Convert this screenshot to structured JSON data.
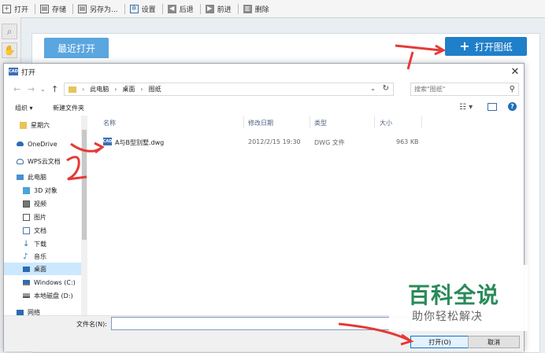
{
  "toolbar": {
    "items": [
      {
        "label": "打开",
        "icon": "plus-icon"
      },
      {
        "label": "存储",
        "icon": "save-icon"
      },
      {
        "label": "另存为...",
        "icon": "save-as-icon"
      },
      {
        "label": "设置",
        "icon": "gear-icon"
      },
      {
        "label": "后退",
        "icon": "back-icon"
      },
      {
        "label": "前进",
        "icon": "forward-icon"
      },
      {
        "label": "删除",
        "icon": "delete-icon"
      }
    ]
  },
  "main": {
    "recent_tab": "最近打开",
    "open_drawing_button": "打开图纸"
  },
  "dialog": {
    "title": "打开",
    "breadcrumb": [
      "此电脑",
      "桌面",
      "图纸"
    ],
    "search_placeholder": "搜索\"图纸\"",
    "organize": "组织 ▾",
    "new_folder": "新建文件夹",
    "nav_items": [
      {
        "label": "星期六",
        "icon": "folder-icon",
        "color": "#e8c35a"
      },
      {
        "label": "OneDrive",
        "icon": "cloud-icon",
        "color": "#2b6cb0"
      },
      {
        "label": "WPS云文档",
        "icon": "cloud-outline-icon",
        "color": "#3a6ea5"
      },
      {
        "label": "此电脑",
        "icon": "computer-icon",
        "color": "#4a8fd1"
      },
      {
        "label": "3D 对象",
        "icon": "cube-icon",
        "color": "#4aa5d8"
      },
      {
        "label": "视频",
        "icon": "video-icon",
        "color": "#555555"
      },
      {
        "label": "图片",
        "icon": "picture-icon",
        "color": "#555555"
      },
      {
        "label": "文档",
        "icon": "document-icon",
        "color": "#5577aa"
      },
      {
        "label": "下载",
        "icon": "download-icon",
        "color": "#2b6cb0"
      },
      {
        "label": "音乐",
        "icon": "music-icon",
        "color": "#2b6cb0"
      },
      {
        "label": "桌面",
        "icon": "desktop-icon",
        "color": "#2b6cb0",
        "selected": true
      },
      {
        "label": "Windows (C:)",
        "icon": "drive-windows-icon",
        "color": "#2b6cb0"
      },
      {
        "label": "本地磁盘 (D:)",
        "icon": "drive-icon",
        "color": "#555555"
      },
      {
        "label": "网络",
        "icon": "network-icon",
        "color": "#2b6cb0"
      }
    ],
    "columns": [
      "名称",
      "修改日期",
      "类型",
      "大小"
    ],
    "files": [
      {
        "name": "A与B型别墅.dwg",
        "date": "2012/2/15 19:30",
        "type": "DWG 文件",
        "size": "963 KB",
        "icon": "cad-file-icon"
      }
    ],
    "filename_label": "文件名(N):",
    "filename_value": "",
    "open_button": "打开(O)",
    "cancel_button": "取消"
  },
  "annotations": {
    "mark_1": "1",
    "mark_2": "2",
    "arrow_color": "#e53935"
  },
  "watermark": {
    "title": "百科全说",
    "subtitle": "助你轻松解决"
  }
}
